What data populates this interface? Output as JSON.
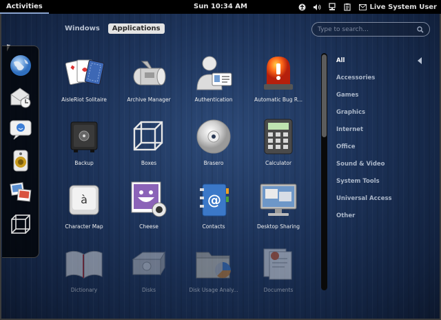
{
  "topbar": {
    "activities": "Activities",
    "clock": "Sun 10:34 AM",
    "user": "Live System User"
  },
  "tabs": [
    {
      "label": "Windows",
      "active": false
    },
    {
      "label": "Applications",
      "active": true
    }
  ],
  "search": {
    "placeholder": "Type to search..."
  },
  "apps": [
    {
      "label": "AisleRiot Solitaire",
      "icon": "cards-icon"
    },
    {
      "label": "Archive Manager",
      "icon": "archive-icon"
    },
    {
      "label": "Authentication",
      "icon": "person-card-icon"
    },
    {
      "label": "Automatic Bug R...",
      "icon": "alarm-light-icon"
    },
    {
      "label": "Backup",
      "icon": "safe-icon"
    },
    {
      "label": "Boxes",
      "icon": "cube-frame-icon"
    },
    {
      "label": "Brasero",
      "icon": "disc-icon"
    },
    {
      "label": "Calculator",
      "icon": "calculator-icon"
    },
    {
      "label": "Character Map",
      "icon": "key-a-grave-icon"
    },
    {
      "label": "Cheese",
      "icon": "cheese-camera-icon"
    },
    {
      "label": "Contacts",
      "icon": "address-book-icon"
    },
    {
      "label": "Desktop Sharing",
      "icon": "monitor-icon"
    },
    {
      "label": "Dictionary",
      "icon": "book-icon"
    },
    {
      "label": "Disks",
      "icon": "hard-disk-icon"
    },
    {
      "label": "Disk Usage Analy...",
      "icon": "folder-chart-icon"
    },
    {
      "label": "Documents",
      "icon": "documents-icon"
    }
  ],
  "categories": [
    {
      "label": "All",
      "active": true
    },
    {
      "label": "Accessories"
    },
    {
      "label": "Games"
    },
    {
      "label": "Graphics"
    },
    {
      "label": "Internet"
    },
    {
      "label": "Office"
    },
    {
      "label": "Sound & Video"
    },
    {
      "label": "System Tools"
    },
    {
      "label": "Universal Access"
    },
    {
      "label": "Other"
    }
  ],
  "dash": [
    {
      "icon": "web-browser-globe-icon"
    },
    {
      "icon": "mail-clock-icon"
    },
    {
      "icon": "chat-bubble-icon"
    },
    {
      "icon": "speaker-icon"
    },
    {
      "icon": "photos-icon"
    },
    {
      "icon": "cube-frame-icon"
    }
  ],
  "colors": {
    "topbar": "#000000",
    "background": "#1c3258",
    "category_text": "#aab6c8",
    "tab_active": "#e4e4e4"
  }
}
